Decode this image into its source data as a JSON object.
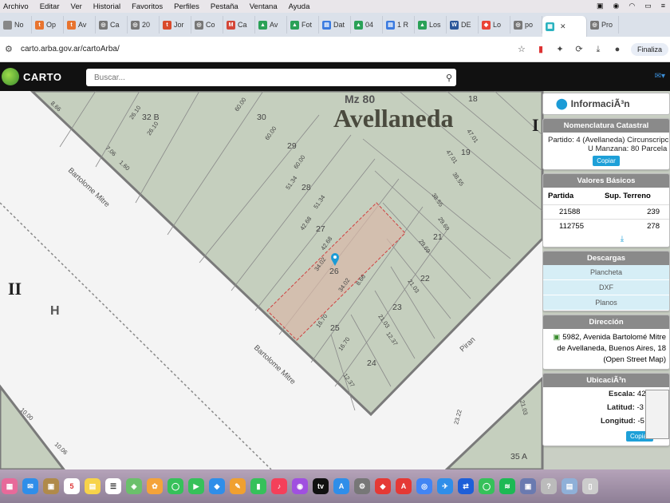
{
  "menubar": {
    "items": [
      "Archivo",
      "Editar",
      "Ver",
      "Historial",
      "Favoritos",
      "Perfiles",
      "Pestaña",
      "Ventana",
      "Ayuda"
    ]
  },
  "tabs": [
    {
      "label": "No",
      "color": "#888"
    },
    {
      "label": "Op",
      "color": "#e8742f"
    },
    {
      "label": "Av",
      "color": "#e8742f"
    },
    {
      "label": "Ca",
      "color": "#777"
    },
    {
      "label": "20",
      "color": "#777"
    },
    {
      "label": "Jor",
      "color": "#d94a2b"
    },
    {
      "label": "Co",
      "color": "#777"
    },
    {
      "label": "Ca",
      "color": "#d44638"
    },
    {
      "label": "Av",
      "color": "#2aa157"
    },
    {
      "label": "Fot",
      "color": "#2aa157"
    },
    {
      "label": "Dat",
      "color": "#3b7be0"
    },
    {
      "label": "04",
      "color": "#2aa157"
    },
    {
      "label": "1 R",
      "color": "#3b7be0"
    },
    {
      "label": "Los",
      "color": "#2aa157"
    },
    {
      "label": "DE",
      "color": "#2b579a"
    },
    {
      "label": "Lo",
      "color": "#ea4335"
    },
    {
      "label": "po",
      "color": "#777"
    },
    {
      "label": "Pro",
      "color": "#777"
    }
  ],
  "address": {
    "url": "carto.arba.gov.ar/cartoArba/",
    "finalize": "Finaliza"
  },
  "app": {
    "logo": "CARTO",
    "search_placeholder": "Buscar..."
  },
  "map": {
    "block_label": "Mz 80",
    "locality": "Avellaneda",
    "selected_parcel": "26",
    "roman_left": "II",
    "roman_right": "I",
    "h_label": "H",
    "streets": [
      "Bartolome Mitre",
      "Bartolome Mitre",
      "Piran"
    ],
    "parcels": [
      "32 B",
      "30",
      "29",
      "28",
      "27",
      "26",
      "25",
      "24",
      "23",
      "22",
      "21",
      "19",
      "18",
      "35 A"
    ],
    "dimensions": [
      "8.66",
      "26.10",
      "26.10",
      "60.00",
      "60.00",
      "60.00",
      "51.34",
      "51.34",
      "42.68",
      "42.68",
      "34.02",
      "34.02",
      "8.66",
      "16.70",
      "16.70",
      "12.37",
      "12.37",
      "21.03",
      "21.03",
      "29.69",
      "29.69",
      "38.55",
      "38.55",
      "47.01",
      "47.01",
      "7.06",
      "1.60",
      "10.00",
      "10.06",
      "23.22",
      "21.03"
    ]
  },
  "panel": {
    "title": "InformaciÃ³n",
    "nomenclatura": {
      "header": "Nomenclatura Catastral",
      "line1": "Partido: 4 (Avellaneda) Circunscripción",
      "line2": "U Manzana: 80 Parcela",
      "copy": "Copiar"
    },
    "valores": {
      "header": "Valores Básicos",
      "col1": "Partida",
      "col2": "Sup. Terreno",
      "rows": [
        {
          "partida": "21588",
          "sup": "239"
        },
        {
          "partida": "112755",
          "sup": "278"
        }
      ]
    },
    "descargas": {
      "header": "Descargas",
      "items": [
        "Plancheta",
        "DXF",
        "Planos"
      ]
    },
    "direccion": {
      "header": "Dirección",
      "line1": "5982, Avenida Bartolomé Mitre",
      "line2": "de Avellaneda, Buenos Aires, 18",
      "line3": "(Open Street Map)"
    },
    "ubicacion": {
      "header": "UbicaciÃ³n",
      "escala_label": "Escala:",
      "escala_value": "423.19",
      "lat_label": "Latitud:",
      "lat_value": "-3",
      "lon_label": "Longitud:",
      "lon_value": "-5",
      "copy": "Copiar"
    }
  }
}
